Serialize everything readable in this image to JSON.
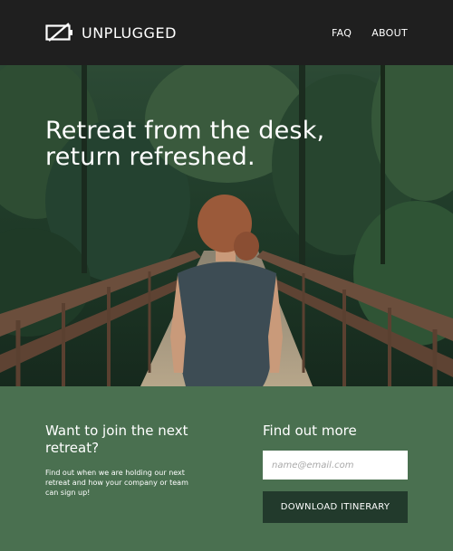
{
  "header": {
    "brand": "UNPLUGGED",
    "logo_icon": "unplugged-battery-icon",
    "nav": [
      {
        "label": "FAQ"
      },
      {
        "label": "ABOUT"
      }
    ]
  },
  "hero": {
    "headline_line1": "Retreat from the desk,",
    "headline_line2": "return refreshed."
  },
  "join": {
    "title": "Want to join the next retreat?",
    "text": "Find out when we are holding our next retreat and how your company or team can sign up!"
  },
  "signup": {
    "title": "Find out more",
    "email_placeholder": "name@email.com",
    "email_value": "",
    "button_label": "DOWNLOAD ITINERARY"
  },
  "colors": {
    "header_bg": "#1f1f1f",
    "footer_bg": "#4a7050",
    "button_bg": "#223a2c",
    "text": "#ffffff"
  }
}
